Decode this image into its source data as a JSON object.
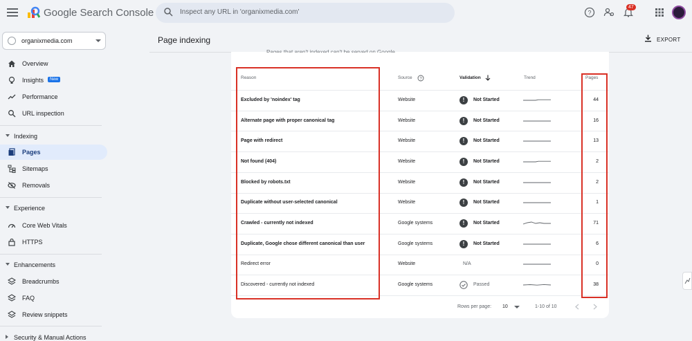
{
  "app": {
    "brand": "Google Search Console",
    "search_placeholder": "Inspect any URL in 'organixmedia.com'",
    "notification_count": "47",
    "brand_colors": {
      "blue": "#4285f4",
      "red": "#ea4335",
      "yellow": "#fbbc05",
      "green": "#34a853"
    }
  },
  "sidebar": {
    "property": "organixmedia.com",
    "items_top": [
      {
        "label": "Overview",
        "icon": "home-icon"
      },
      {
        "label": "Insights",
        "icon": "lightbulb-icon",
        "badge": "New"
      },
      {
        "label": "Performance",
        "icon": "trending-icon"
      },
      {
        "label": "URL inspection",
        "icon": "search-icon"
      }
    ],
    "indexing": {
      "title": "Indexing",
      "items": [
        {
          "label": "Pages",
          "icon": "pages-icon",
          "active": true
        },
        {
          "label": "Sitemaps",
          "icon": "sitemap-icon"
        },
        {
          "label": "Removals",
          "icon": "removals-icon"
        }
      ]
    },
    "experience": {
      "title": "Experience",
      "items": [
        {
          "label": "Core Web Vitals",
          "icon": "speed-icon"
        },
        {
          "label": "HTTPS",
          "icon": "lock-icon"
        }
      ]
    },
    "enhancements": {
      "title": "Enhancements",
      "items": [
        {
          "label": "Breadcrumbs",
          "icon": "layers-icon"
        },
        {
          "label": "FAQ",
          "icon": "layers-icon"
        },
        {
          "label": "Review snippets",
          "icon": "layers-icon"
        }
      ]
    },
    "security": {
      "title": "Security & Manual Actions"
    }
  },
  "header": {
    "title": "Page indexing",
    "export_label": "EXPORT",
    "subtitle_clipped": "Pages that aren't indexed can't be served on Google"
  },
  "table": {
    "columns": {
      "reason": "Reason",
      "source": "Source",
      "validation": "Validation",
      "trend": "Trend",
      "pages": "Pages"
    },
    "rows": [
      {
        "reason": "Excluded by 'noindex' tag",
        "source": "Website",
        "validation": "Not Started",
        "status": "not_started",
        "trend": "flat-up",
        "pages": "44",
        "bold": true
      },
      {
        "reason": "Alternate page with proper canonical tag",
        "source": "Website",
        "validation": "Not Started",
        "status": "not_started",
        "trend": "flat",
        "pages": "16",
        "bold": true
      },
      {
        "reason": "Page with redirect",
        "source": "Website",
        "validation": "Not Started",
        "status": "not_started",
        "trend": "flat",
        "pages": "13",
        "bold": true
      },
      {
        "reason": "Not found (404)",
        "source": "Website",
        "validation": "Not Started",
        "status": "not_started",
        "trend": "flat-up",
        "pages": "2",
        "bold": true
      },
      {
        "reason": "Blocked by robots.txt",
        "source": "Website",
        "validation": "Not Started",
        "status": "not_started",
        "trend": "flat",
        "pages": "2",
        "bold": true
      },
      {
        "reason": "Duplicate without user-selected canonical",
        "source": "Website",
        "validation": "Not Started",
        "status": "not_started",
        "trend": "flat",
        "pages": "1",
        "bold": true
      },
      {
        "reason": "Crawled - currently not indexed",
        "source": "Google systems",
        "validation": "Not Started",
        "status": "not_started",
        "trend": "wave",
        "pages": "71",
        "bold": true
      },
      {
        "reason": "Duplicate, Google chose different canonical than user",
        "source": "Google systems",
        "validation": "Not Started",
        "status": "not_started",
        "trend": "flat",
        "pages": "6",
        "bold": true
      },
      {
        "reason": "Redirect error",
        "source": "Website",
        "validation": "N/A",
        "status": "na",
        "trend": "flat",
        "pages": "0",
        "bold": false
      },
      {
        "reason": "Discovered - currently not indexed",
        "source": "Google systems",
        "validation": "Passed",
        "status": "passed",
        "trend": "small-wave",
        "pages": "38",
        "bold": false
      }
    ],
    "pagination": {
      "rows_label": "Rows per page:",
      "rows_value": "10",
      "range": "1-10 of 10"
    }
  },
  "highlight_color": "#d93025"
}
